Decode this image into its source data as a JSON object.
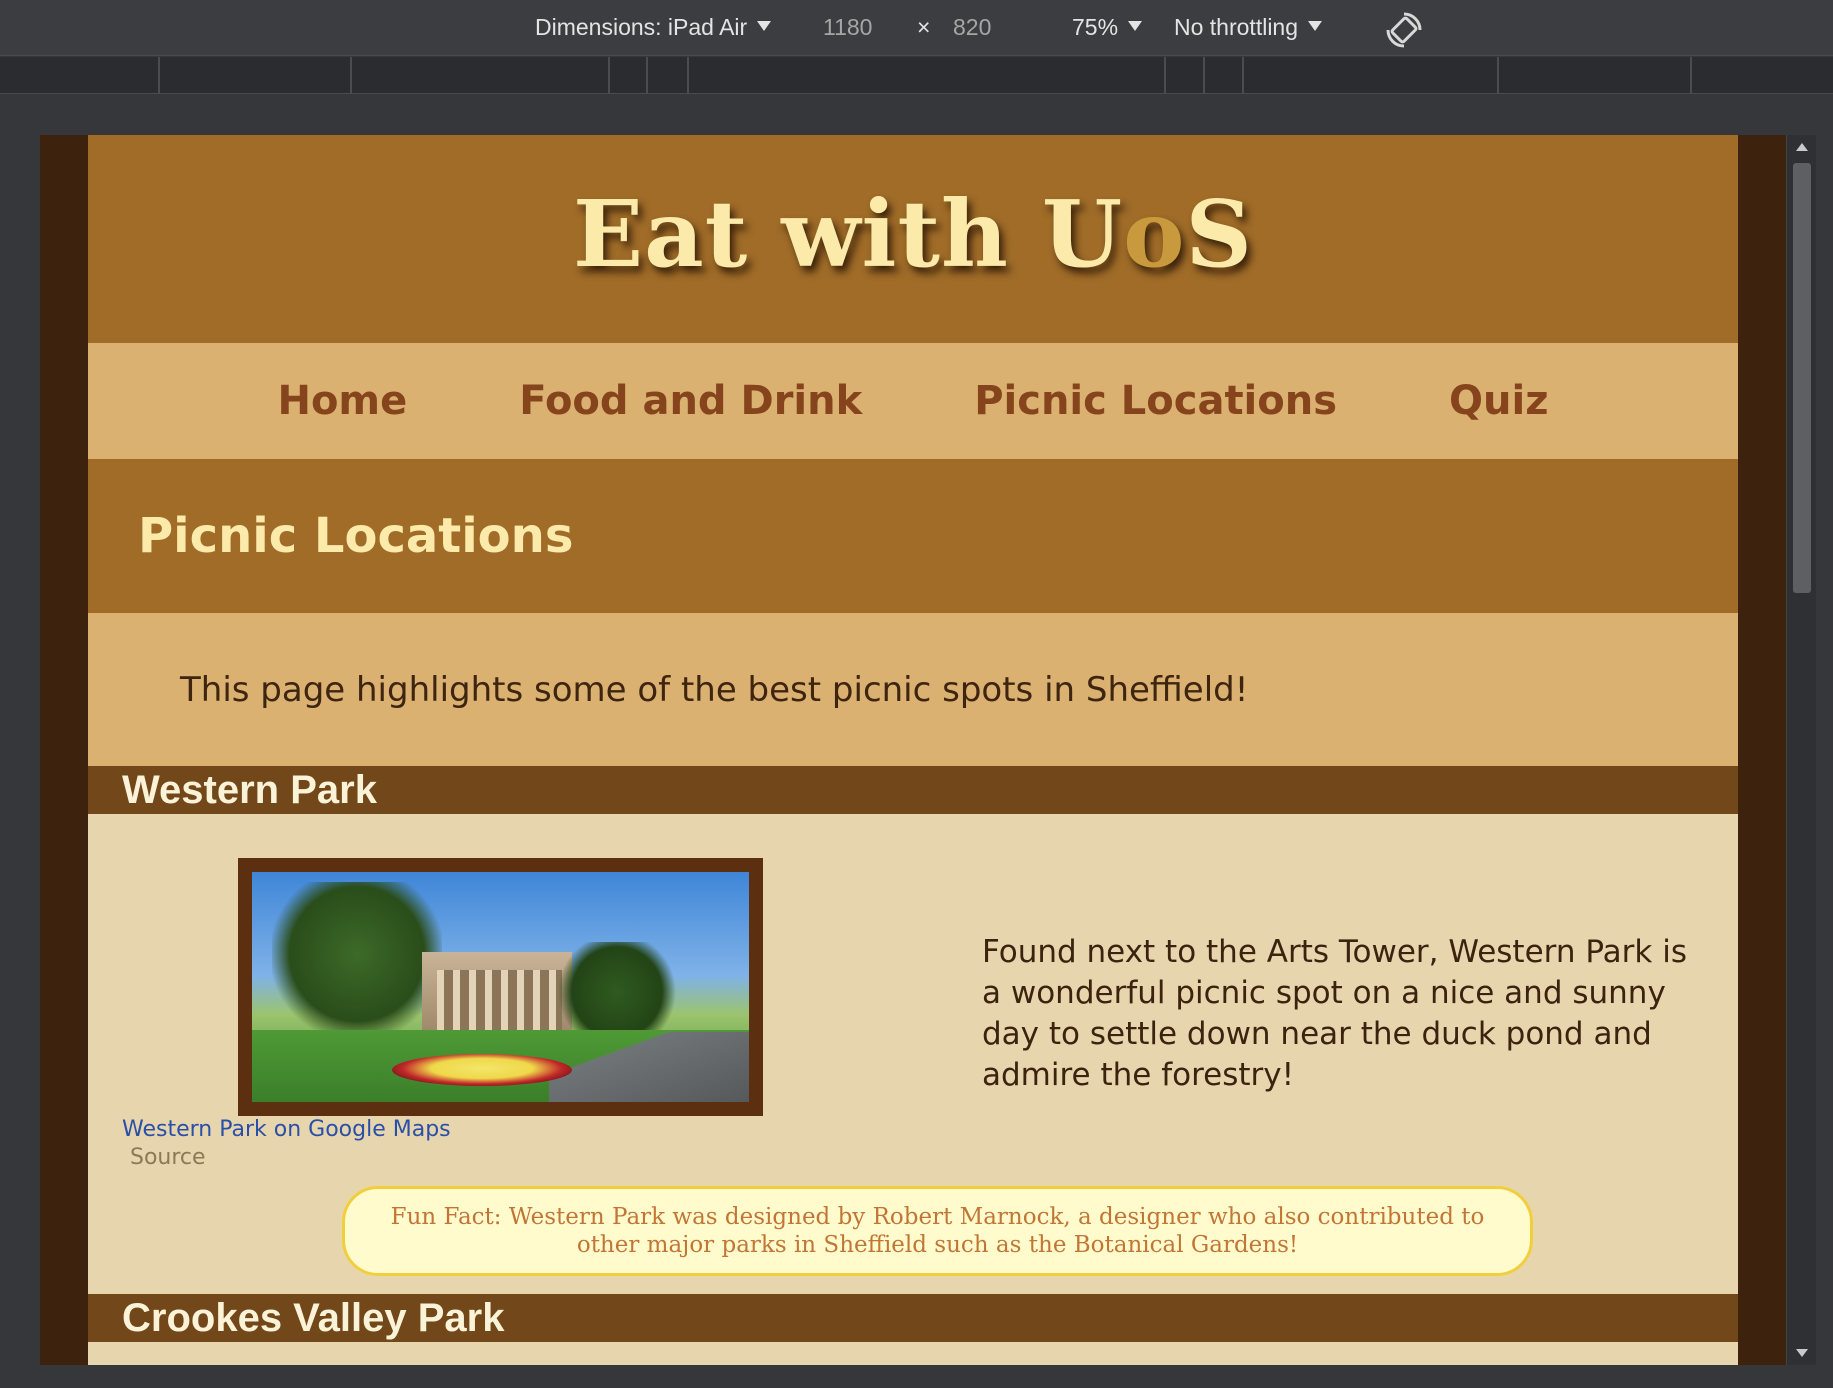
{
  "devtools": {
    "dimensions_label": "Dimensions: iPad Air",
    "width": "1180",
    "times": "×",
    "height": "820",
    "zoom": "75%",
    "throttling": "No throttling",
    "rotate_icon": "rotate-device-icon"
  },
  "site": {
    "title_main": "Eat with U",
    "title_accent": "o",
    "title_end": "S",
    "colors": {
      "header": "#a06c28",
      "nav": "#dbb172",
      "section_bar": "#72471a",
      "content": "#e7d6ad",
      "title": "#fbeaa9"
    }
  },
  "nav": {
    "items": [
      "Home",
      "Food and Drink",
      "Picnic Locations",
      "Quiz"
    ]
  },
  "page": {
    "heading": "Picnic Locations",
    "intro": "This page highlights some of the best picnic spots in Sheffield!"
  },
  "sections": [
    {
      "title": "Western Park",
      "image_alt": "Western Park photo",
      "map_link": "Western Park on Google Maps",
      "source": "Source",
      "description": "Found next to the Arts Tower, Western Park is a wonderful picnic spot on a nice and sunny day to settle down near the duck pond and admire the forestry!",
      "fun_fact": "Fun Fact: Western Park was designed by Robert Marnock, a designer who also contributed to other major parks in Sheffield such as the Botanical Gardens!"
    },
    {
      "title": "Crookes Valley Park"
    }
  ]
}
